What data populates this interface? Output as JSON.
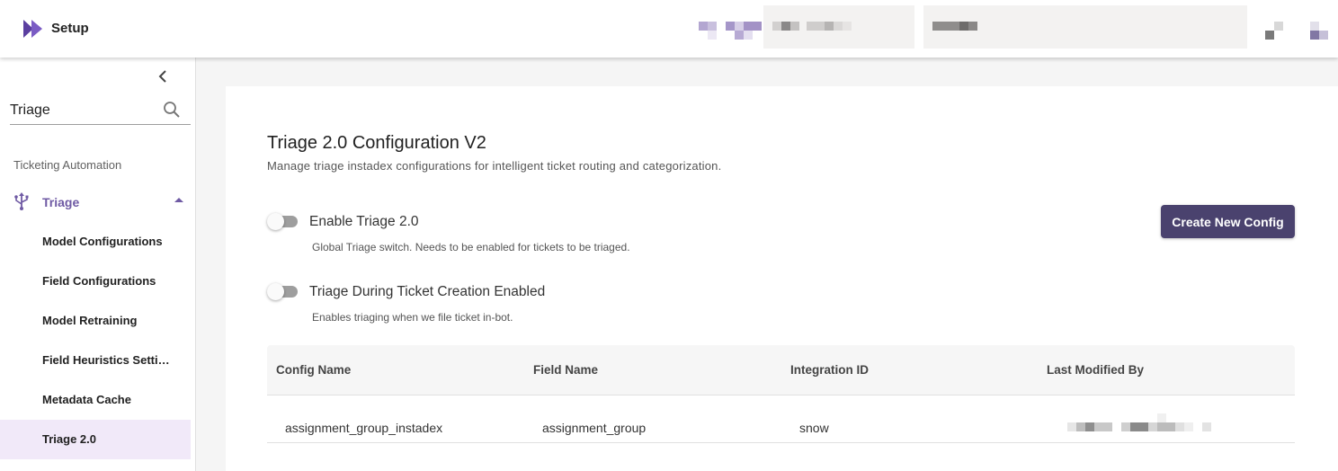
{
  "header": {
    "title": "Setup",
    "logo_color": "#5b3fa0"
  },
  "sidebar": {
    "search": {
      "value": "Triage",
      "placeholder": "Search"
    },
    "section_label": "Ticketing Automation",
    "parent": {
      "label": "Triage",
      "icon": "usb-icon",
      "expanded": true
    },
    "children": [
      {
        "label": "Model Configurations"
      },
      {
        "label": "Field Configurations"
      },
      {
        "label": "Model Retraining"
      },
      {
        "label": "Field Heuristics Settings"
      },
      {
        "label": "Metadata Cache"
      },
      {
        "label": "Triage 2.0",
        "active": true
      }
    ],
    "accent_color": "#6f5aa4"
  },
  "main": {
    "title": "Triage 2.0 Configuration V2",
    "subtitle": "Manage triage instadex configurations for intelligent ticket routing and categorization.",
    "create_button": "Create New Config",
    "toggles": [
      {
        "label": "Enable Triage 2.0",
        "help": "Global Triage switch. Needs to be enabled for tickets to be triaged.",
        "on": false
      },
      {
        "label": "Triage During Ticket Creation Enabled",
        "help": "Enables triaging when we file ticket in-bot.",
        "on": false
      }
    ],
    "table": {
      "columns": [
        "Config Name",
        "Field Name",
        "Integration ID",
        "Last Modified By"
      ],
      "rows": [
        {
          "config_name": "assignment_group_instadex",
          "field_name": "assignment_group",
          "integration_id": "snow"
        }
      ]
    }
  }
}
